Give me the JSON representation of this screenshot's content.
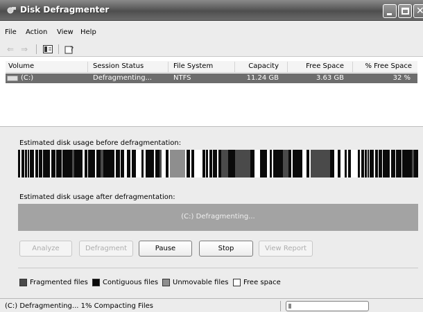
{
  "window": {
    "title": "Disk Defragmenter"
  },
  "menu": [
    "File",
    "Action",
    "View",
    "Help"
  ],
  "toolbar": {
    "icons": [
      "back-arrow-icon",
      "forward-arrow-icon",
      "console-tree-icon",
      "help-icon"
    ]
  },
  "list": {
    "columns": [
      "Volume",
      "Session Status",
      "File System",
      "Capacity",
      "Free Space",
      "% Free Space"
    ],
    "rows": [
      {
        "volume": "(C:)",
        "status": "Defragmenting...",
        "fs": "NTFS",
        "capacity": "11.24 GB",
        "free": "3.63 GB",
        "pct_free": "32 %"
      }
    ]
  },
  "analysis": {
    "before_label": "Estimated disk usage before defragmentation:",
    "after_label": "Estimated disk usage after defragmentation:",
    "after_status": "(C:) Defragmenting..."
  },
  "buttons": {
    "analyze": "Analyze",
    "defragment": "Defragment",
    "pause": "Pause",
    "stop": "Stop",
    "view_report": "View Report"
  },
  "legend": {
    "fragmented": "Fragmented files",
    "contiguous": "Contiguous files",
    "unmovable": "Unmovable files",
    "free": "Free space"
  },
  "colors": {
    "fragmented": "#4a4a4a",
    "contiguous": "#0a0a0a",
    "unmovable": "#8e8e8e",
    "free": "#ffffff"
  },
  "status": {
    "text": "(C:) Defragmenting... 1%  Compacting Files",
    "progress": 0.01
  }
}
